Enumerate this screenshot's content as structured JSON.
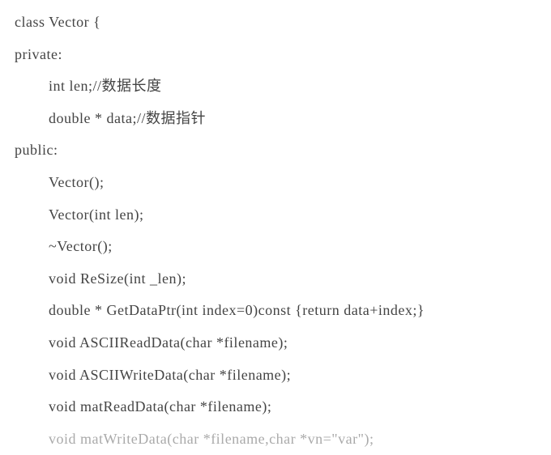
{
  "code": {
    "lines": [
      {
        "indent": 0,
        "text": "class Vector {"
      },
      {
        "indent": 0,
        "text": "private:"
      },
      {
        "indent": 1,
        "text": "int len;//数据长度"
      },
      {
        "indent": 1,
        "text": "double * data;//数据指针"
      },
      {
        "indent": 0,
        "text": "public:"
      },
      {
        "indent": 1,
        "text": "Vector();"
      },
      {
        "indent": 1,
        "text": "Vector(int len);"
      },
      {
        "indent": 1,
        "text": "~Vector();"
      },
      {
        "indent": 1,
        "text": "void ReSize(int _len);"
      },
      {
        "indent": 1,
        "text": "double * GetDataPtr(int index=0)const {return data+index;}"
      },
      {
        "indent": 1,
        "text": "void ASCIIReadData(char *filename);"
      },
      {
        "indent": 1,
        "text": "void ASCIIWriteData(char *filename);"
      },
      {
        "indent": 1,
        "text": "void matReadData(char *filename);"
      },
      {
        "indent": 1,
        "text": "void matWriteData(char *filename,char *vn=\"var\");"
      }
    ]
  }
}
